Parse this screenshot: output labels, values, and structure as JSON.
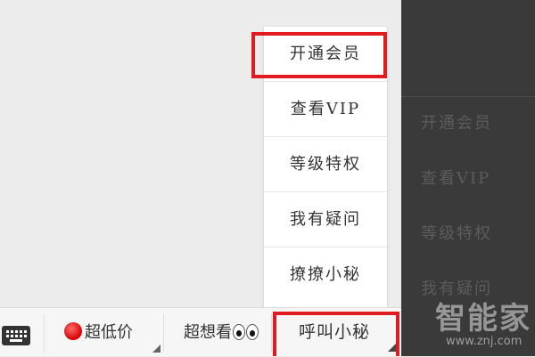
{
  "popup_menu": {
    "items": [
      {
        "label": "开通会员"
      },
      {
        "label": "查看VIP"
      },
      {
        "label": "等级特权"
      },
      {
        "label": "我有疑问"
      },
      {
        "label": "撩撩小秘"
      }
    ]
  },
  "background_menu": {
    "items": [
      {
        "label": "开通会员"
      },
      {
        "label": "查看VIP"
      },
      {
        "label": "等级特权"
      },
      {
        "label": "我有疑问"
      }
    ]
  },
  "bottom_bar": {
    "keyboard_icon": "keyboard-icon",
    "price_label": "超低价",
    "price_icon": "red-circle-icon",
    "watch_label": "超想看",
    "watch_icon": "eyes-icon",
    "call_label": "呼叫小秘"
  },
  "watermark": {
    "logo_text": "智能家",
    "url": "www.znj.com"
  },
  "colors": {
    "highlight": "#e01b22",
    "dark_panel": "#3a3a3a"
  }
}
